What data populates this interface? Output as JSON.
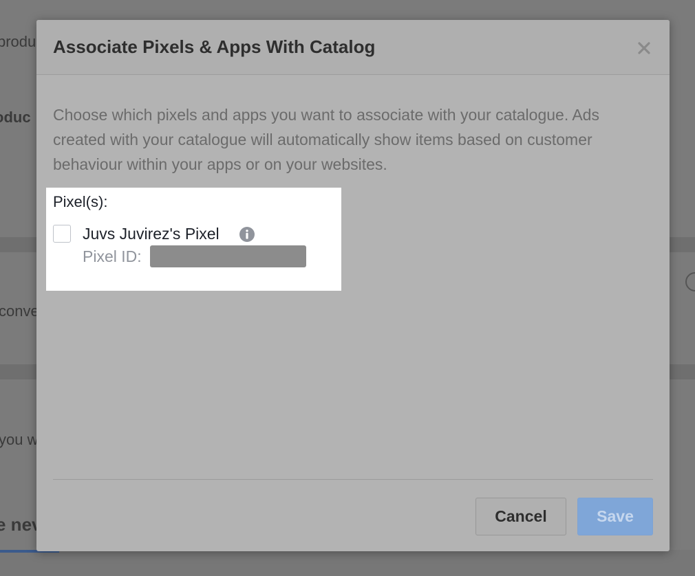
{
  "background": {
    "snippets": [
      "produ",
      "oduc",
      "conve",
      "you w",
      "e nev"
    ]
  },
  "modal": {
    "title": "Associate Pixels & Apps With Catalog",
    "close_icon": "close-icon",
    "description": "Choose which pixels and apps you want to associate with your catalogue. Ads created with your catalogue will automatically show items based on customer behaviour within your apps or on your websites.",
    "pixels_section": {
      "heading": "Pixel(s):",
      "items": [
        {
          "name": "Juvs Juvirez's Pixel",
          "checked": false,
          "info_icon": "info-icon",
          "id_label": "Pixel ID:"
        }
      ]
    },
    "footer": {
      "cancel_label": "Cancel",
      "save_label": "Save"
    }
  },
  "colors": {
    "primary_blue": "#4080ff",
    "save_disabled": "#7fa6d8"
  }
}
